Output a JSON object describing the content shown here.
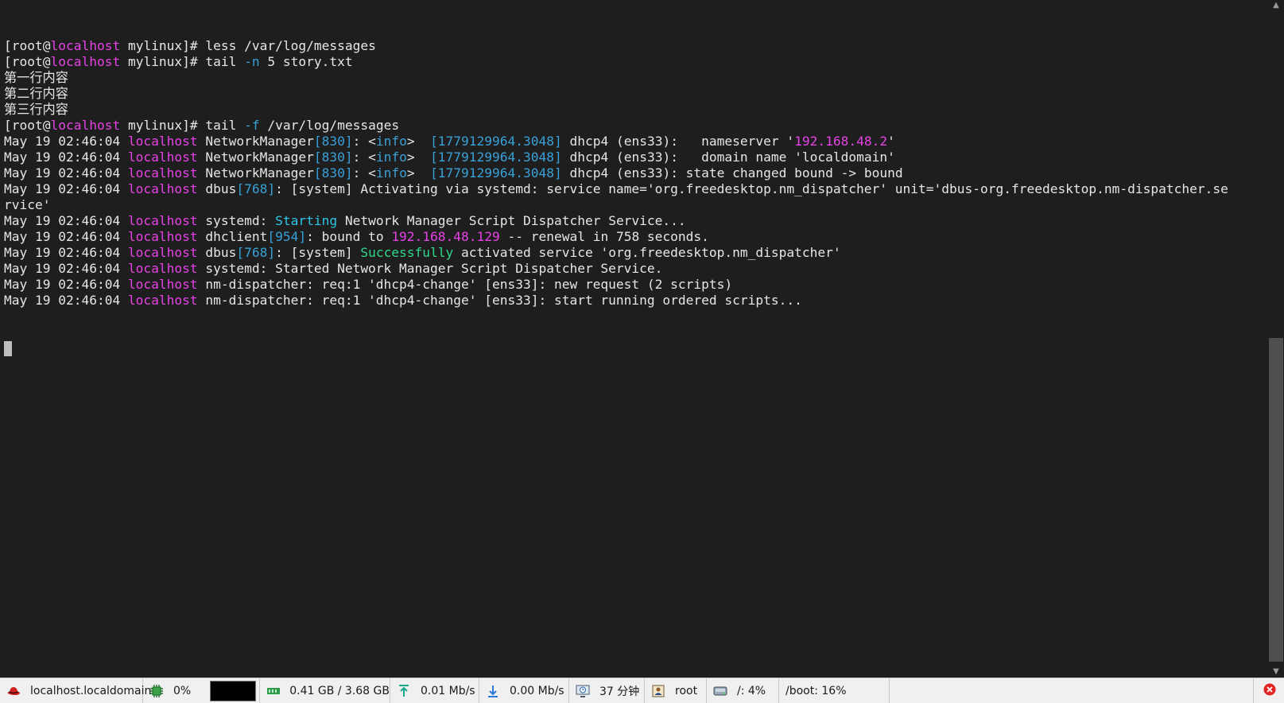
{
  "palette": {
    "default": "#e6e6e6",
    "magenta": "#e642e6",
    "blue": "#3aa0d8",
    "cyan": "#2ec5e8",
    "green": "#2ed88a"
  },
  "terminal": {
    "lines": [
      [
        {
          "t": "[root@"
        },
        {
          "t": "localhost",
          "c": "magenta"
        },
        {
          "t": " mylinux]# less /var/log/messages"
        }
      ],
      [
        {
          "t": "[root@"
        },
        {
          "t": "localhost",
          "c": "magenta"
        },
        {
          "t": " mylinux]# tail "
        },
        {
          "t": "-n",
          "c": "blue"
        },
        {
          "t": " 5 story.txt"
        }
      ],
      [
        {
          "t": "第一行内容"
        }
      ],
      [
        {
          "t": "第二行内容"
        }
      ],
      [
        {
          "t": "第三行内容"
        }
      ],
      [
        {
          "t": "[root@"
        },
        {
          "t": "localhost",
          "c": "magenta"
        },
        {
          "t": " mylinux]# tail "
        },
        {
          "t": "-f",
          "c": "blue"
        },
        {
          "t": " /var/log/messages"
        }
      ],
      [
        {
          "t": "May 19 02:46:04 "
        },
        {
          "t": "localhost",
          "c": "magenta"
        },
        {
          "t": " NetworkManager"
        },
        {
          "t": "[830]",
          "c": "blue"
        },
        {
          "t": ": <"
        },
        {
          "t": "info",
          "c": "blue"
        },
        {
          "t": ">  "
        },
        {
          "t": "[1779129964.3048]",
          "c": "blue"
        },
        {
          "t": " dhcp4 (ens33):   nameserver '"
        },
        {
          "t": "192.168.48.2",
          "c": "magenta"
        },
        {
          "t": "'"
        }
      ],
      [
        {
          "t": "May 19 02:46:04 "
        },
        {
          "t": "localhost",
          "c": "magenta"
        },
        {
          "t": " NetworkManager"
        },
        {
          "t": "[830]",
          "c": "blue"
        },
        {
          "t": ": <"
        },
        {
          "t": "info",
          "c": "blue"
        },
        {
          "t": ">  "
        },
        {
          "t": "[1779129964.3048]",
          "c": "blue"
        },
        {
          "t": " dhcp4 (ens33):   domain name 'localdomain'"
        }
      ],
      [
        {
          "t": "May 19 02:46:04 "
        },
        {
          "t": "localhost",
          "c": "magenta"
        },
        {
          "t": " NetworkManager"
        },
        {
          "t": "[830]",
          "c": "blue"
        },
        {
          "t": ": <"
        },
        {
          "t": "info",
          "c": "blue"
        },
        {
          "t": ">  "
        },
        {
          "t": "[1779129964.3048]",
          "c": "blue"
        },
        {
          "t": " dhcp4 (ens33): state changed bound -> bound"
        }
      ],
      [
        {
          "t": "May 19 02:46:04 "
        },
        {
          "t": "localhost",
          "c": "magenta"
        },
        {
          "t": " dbus"
        },
        {
          "t": "[768]",
          "c": "blue"
        },
        {
          "t": ": [system] Activating via systemd: service name='org.freedesktop.nm_dispatcher' unit='dbus-org.freedesktop.nm-dispatcher.se"
        }
      ],
      [
        {
          "t": "rvice'"
        }
      ],
      [
        {
          "t": "May 19 02:46:04 "
        },
        {
          "t": "localhost",
          "c": "magenta"
        },
        {
          "t": " systemd: "
        },
        {
          "t": "Starting",
          "c": "cyan"
        },
        {
          "t": " Network Manager Script Dispatcher Service..."
        }
      ],
      [
        {
          "t": "May 19 02:46:04 "
        },
        {
          "t": "localhost",
          "c": "magenta"
        },
        {
          "t": " dhclient"
        },
        {
          "t": "[954]",
          "c": "blue"
        },
        {
          "t": ": bound to "
        },
        {
          "t": "192.168.48.129",
          "c": "magenta"
        },
        {
          "t": " -- renewal in 758 seconds."
        }
      ],
      [
        {
          "t": "May 19 02:46:04 "
        },
        {
          "t": "localhost",
          "c": "magenta"
        },
        {
          "t": " dbus"
        },
        {
          "t": "[768]",
          "c": "blue"
        },
        {
          "t": ": [system] "
        },
        {
          "t": "Successfully",
          "c": "green"
        },
        {
          "t": " activated service 'org.freedesktop.nm_dispatcher'"
        }
      ],
      [
        {
          "t": "May 19 02:46:04 "
        },
        {
          "t": "localhost",
          "c": "magenta"
        },
        {
          "t": " systemd: Started Network Manager Script Dispatcher Service."
        }
      ],
      [
        {
          "t": "May 19 02:46:04 "
        },
        {
          "t": "localhost",
          "c": "magenta"
        },
        {
          "t": " nm-dispatcher: req:1 'dhcp4-change' [ens33]: new request (2 scripts)"
        }
      ],
      [
        {
          "t": "May 19 02:46:04 "
        },
        {
          "t": "localhost",
          "c": "magenta"
        },
        {
          "t": " nm-dispatcher: req:1 'dhcp4-change' [ens33]: start running ordered scripts..."
        }
      ]
    ]
  },
  "statusbar": {
    "host": "localhost.localdomain",
    "cpu": "0%",
    "memory": "0.41 GB / 3.68 GB",
    "upload": "0.01 Mb/s",
    "download": "0.00 Mb/s",
    "uptime": "37 分钟",
    "user": "root",
    "disk_root": "/: 4%",
    "disk_boot": "/boot: 16%"
  },
  "icons": {
    "host": "redhat-icon",
    "cpu": "cpu-chip-icon",
    "memory": "memory-icon",
    "upload": "upload-arrow-icon",
    "download": "download-arrow-icon",
    "uptime": "monitor-clock-icon",
    "user": "user-icon",
    "disk": "disk-icon",
    "close": "close-icon"
  }
}
